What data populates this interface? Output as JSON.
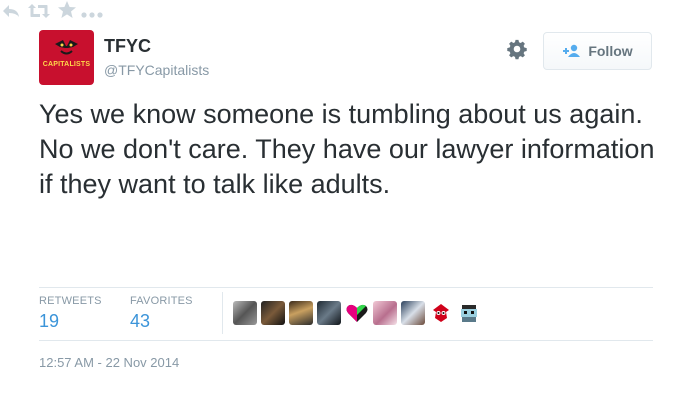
{
  "user": {
    "display_name": "TFYC",
    "screen_name": "@TFYCapitalists",
    "avatar_text": "CAPITALISTS"
  },
  "follow_button": {
    "label": "Follow"
  },
  "tweet": {
    "text": "Yes we know someone is tumbling about us again. No we don't care. They have our lawyer information if they want to talk like adults."
  },
  "stats": {
    "retweets_label": "RETWEETS",
    "retweets_value": "19",
    "favorites_label": "FAVORITES",
    "favorites_value": "43"
  },
  "timestamp": "12:57 AM - 22 Nov 2014",
  "icons": {
    "reply": "reply-icon",
    "retweet": "retweet-icon",
    "favorite": "star-icon",
    "more": "more-icon",
    "gear": "gear-icon",
    "follow": "add-user-icon"
  },
  "colors": {
    "link_blue": "#3b94d9",
    "muted": "#8899a6",
    "avatar_red": "#c8102e",
    "icon_gray": "#ccd6dd"
  },
  "favoriter_avatar_count": 10
}
